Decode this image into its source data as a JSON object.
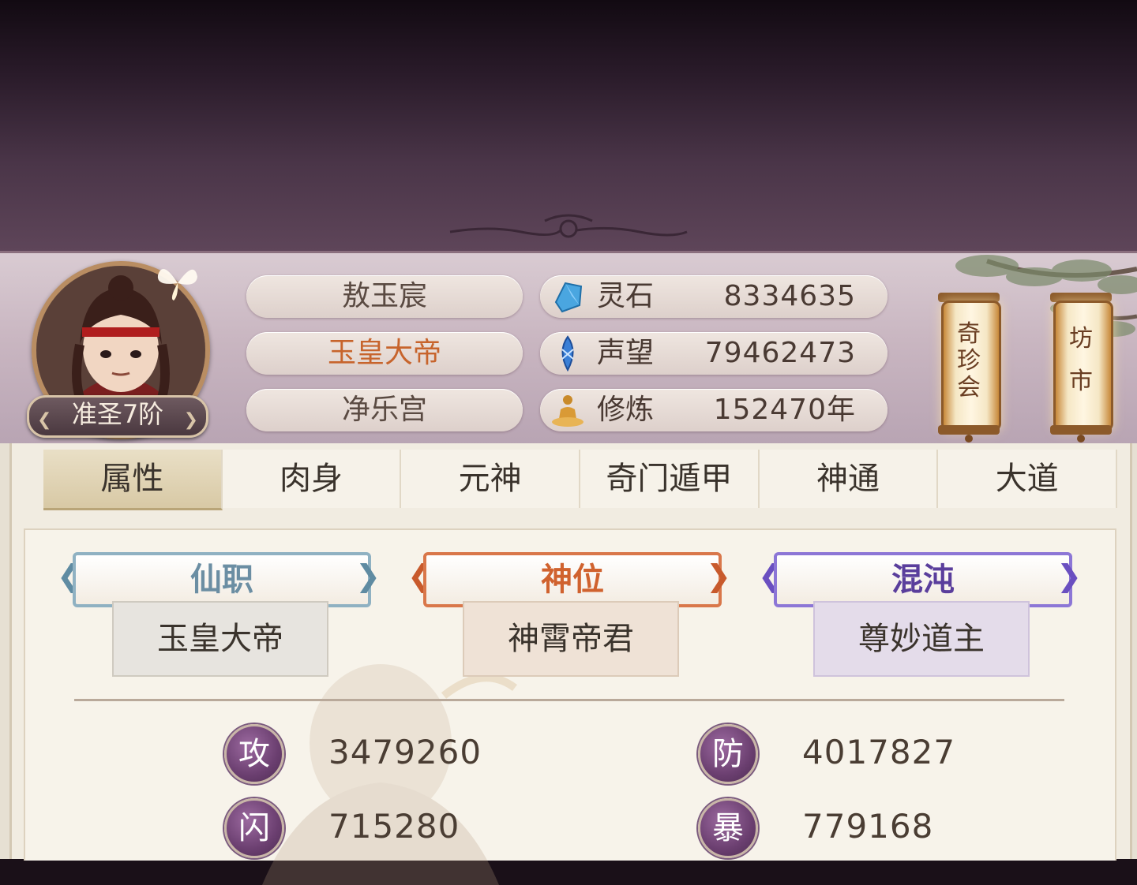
{
  "player": {
    "name": "敖玉宸",
    "title": "玉皇大帝",
    "sect": "净乐宫",
    "rank": "准圣7阶"
  },
  "resources": [
    {
      "icon": "spirit-stone-icon",
      "label": "灵石",
      "value": "8334635"
    },
    {
      "icon": "reputation-crystal-icon",
      "label": "声望",
      "value": "79462473"
    },
    {
      "icon": "meditation-icon",
      "label": "修炼",
      "value": "152470年"
    }
  ],
  "lanterns": [
    {
      "name": "treasure-fair-lantern",
      "lines": [
        "奇",
        "珍",
        "会"
      ]
    },
    {
      "name": "market-lantern",
      "lines": [
        "坊",
        "市"
      ]
    }
  ],
  "tabs": [
    {
      "label": "属性",
      "active": true
    },
    {
      "label": "肉身",
      "active": false
    },
    {
      "label": "元神",
      "active": false
    },
    {
      "label": "奇门遁甲",
      "active": false
    },
    {
      "label": "神通",
      "active": false
    },
    {
      "label": "大道",
      "active": false
    }
  ],
  "titles": [
    {
      "header": "仙职",
      "value": "玉皇大帝",
      "color": "#6b8ea3"
    },
    {
      "header": "神位",
      "value": "神霄帝君",
      "color": "#d0622e"
    },
    {
      "header": "混沌",
      "value": "尊妙道主",
      "color": "#5a3e9c"
    }
  ],
  "stats": [
    {
      "symbol": "攻",
      "value": "3479260"
    },
    {
      "symbol": "防",
      "value": "4017827"
    },
    {
      "symbol": "闪",
      "value": "715280"
    },
    {
      "symbol": "暴",
      "value": "779168"
    }
  ]
}
